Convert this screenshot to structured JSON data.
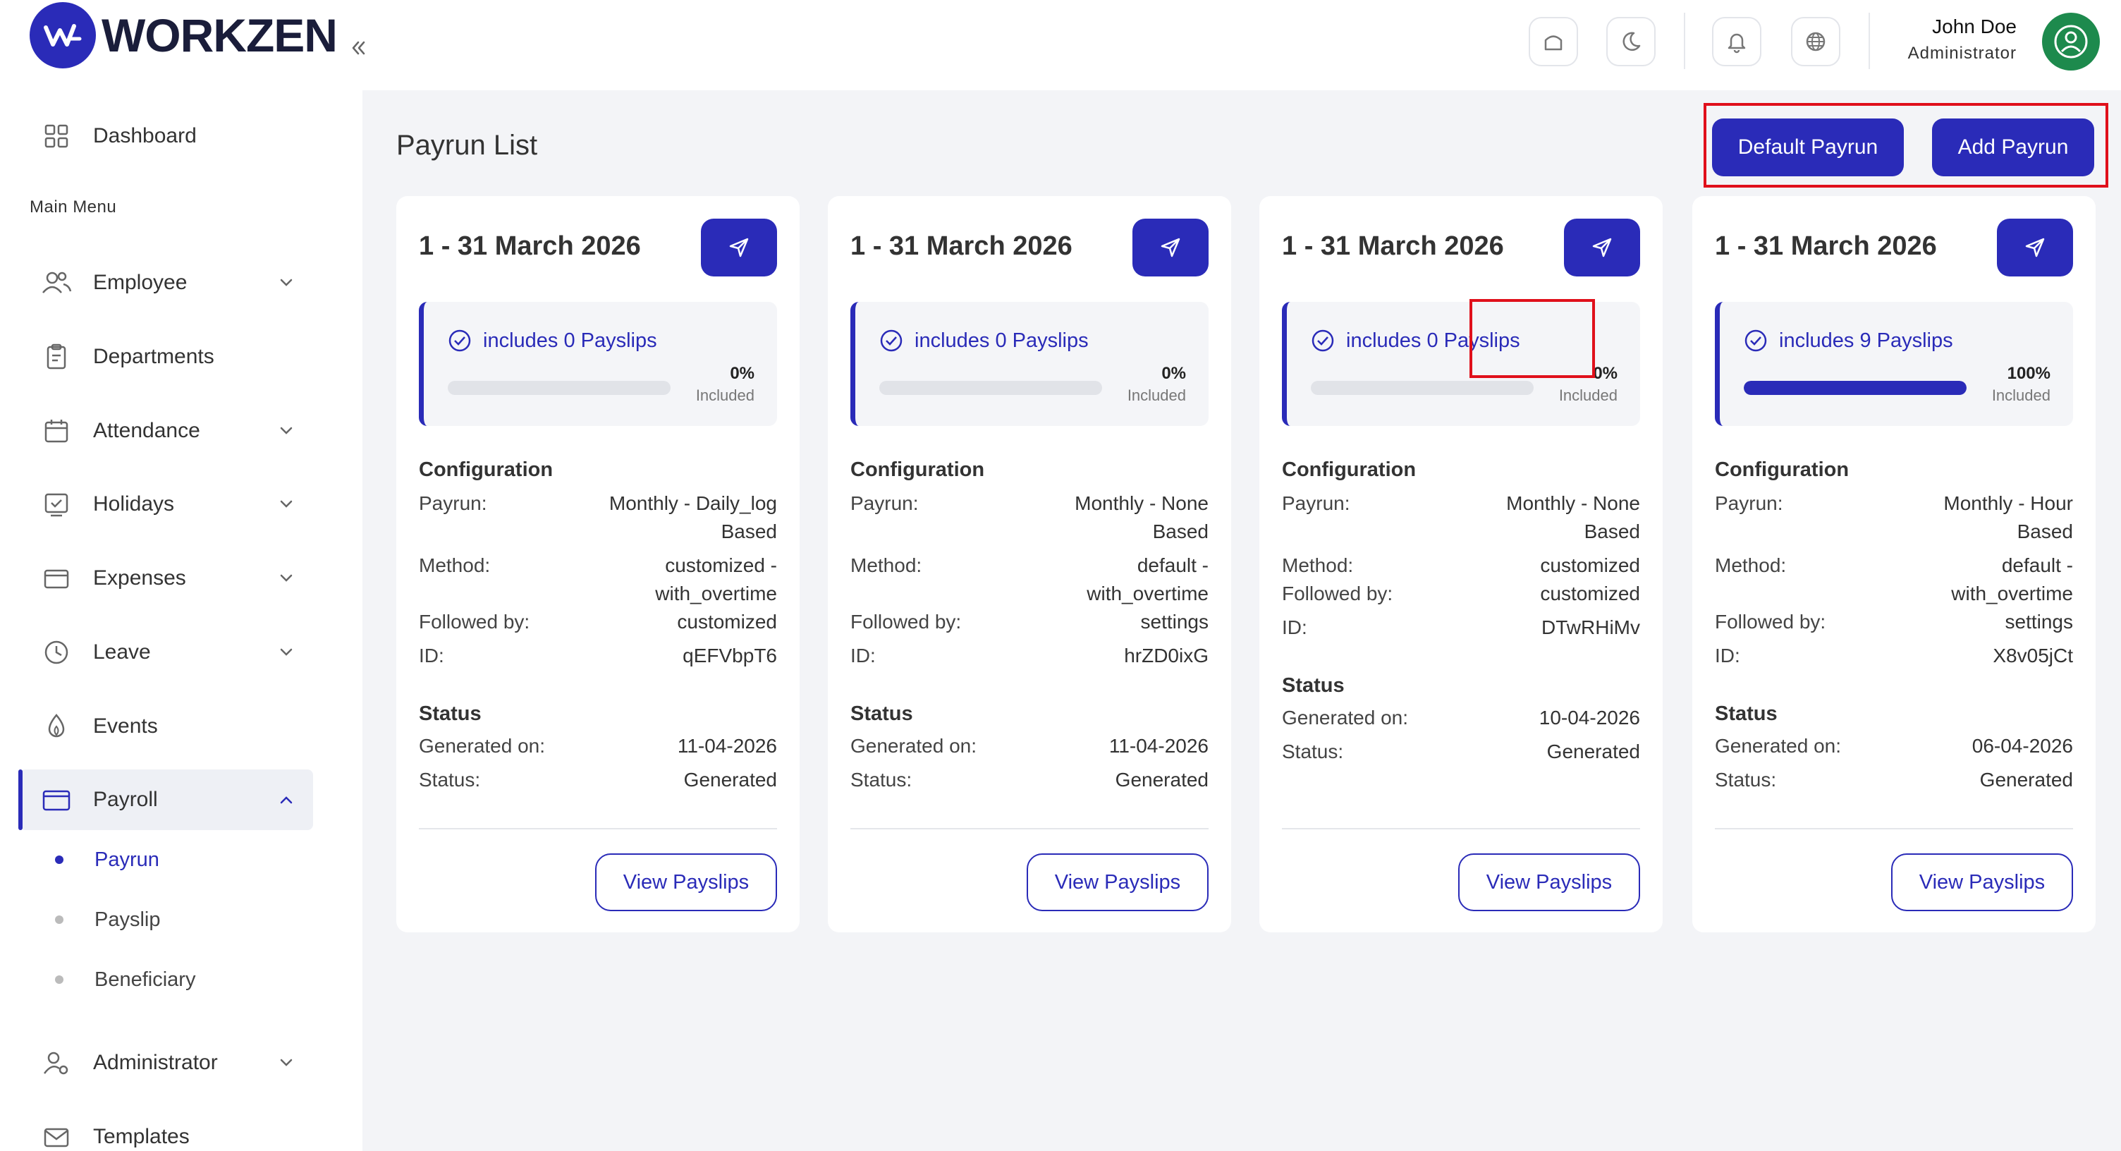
{
  "brand": {
    "name": "WORKZEN",
    "accent": "#2a2bb8"
  },
  "user": {
    "name": "John Doe",
    "role": "Administrator"
  },
  "sidebar": {
    "dashboard": "Dashboard",
    "section_label": "Main Menu",
    "items": [
      {
        "label": "Employee"
      },
      {
        "label": "Departments"
      },
      {
        "label": "Attendance"
      },
      {
        "label": "Holidays"
      },
      {
        "label": "Expenses"
      },
      {
        "label": "Leave"
      },
      {
        "label": "Events"
      },
      {
        "label": "Payroll"
      },
      {
        "label": "Administrator"
      },
      {
        "label": "Templates"
      }
    ],
    "payroll_sub": [
      {
        "label": "Payrun"
      },
      {
        "label": "Payslip"
      },
      {
        "label": "Beneficiary"
      }
    ]
  },
  "main": {
    "title": "Payrun List",
    "default_payrun_label": "Default Payrun",
    "add_payrun_label": "Add Payrun"
  },
  "labels": {
    "configuration": "Configuration",
    "payrun": "Payrun:",
    "method": "Method:",
    "followed_by": "Followed by:",
    "id": "ID:",
    "status_head": "Status",
    "generated_on": "Generated on:",
    "status": "Status:",
    "included": "Included",
    "view_payslips": "View Payslips"
  },
  "cards": [
    {
      "title": "1 - 31 March 2026",
      "payslips": "includes 0 Payslips",
      "progress": 0,
      "pct": "0%",
      "payrun_l1": "Monthly - Daily_log",
      "payrun_l2": "Based",
      "method_l1": "customized -",
      "method_l2": "with_overtime",
      "followed_by": "customized",
      "id": "qEFVbpT6",
      "generated_on": "11-04-2026",
      "status": "Generated"
    },
    {
      "title": "1 - 31 March 2026",
      "payslips": "includes 0 Payslips",
      "progress": 0,
      "pct": "0%",
      "payrun_l1": "Monthly - None",
      "payrun_l2": "Based",
      "method_l1": "default -",
      "method_l2": "with_overtime",
      "followed_by": "settings",
      "id": "hrZD0ixG",
      "generated_on": "11-04-2026",
      "status": "Generated"
    },
    {
      "title": "1 - 31 March 2026",
      "payslips": "includes 0 Payslips",
      "progress": 0,
      "pct": "0%",
      "payrun_l1": "Monthly - None",
      "payrun_l2": "Based",
      "method_l1": "customized",
      "followed_by": "customized",
      "id": "DTwRHiMv",
      "generated_on": "10-04-2026",
      "status": "Generated"
    },
    {
      "title": "1 - 31 March 2026",
      "payslips": "includes 9 Payslips",
      "progress": 1.0,
      "pct": "100%",
      "payrun_l1": "Monthly - Hour",
      "payrun_l2": "Based",
      "method_l1": "default -",
      "method_l2": "with_overtime",
      "followed_by": "settings",
      "id": "X8v05jCt",
      "generated_on": "06-04-2026",
      "status": "Generated"
    }
  ]
}
